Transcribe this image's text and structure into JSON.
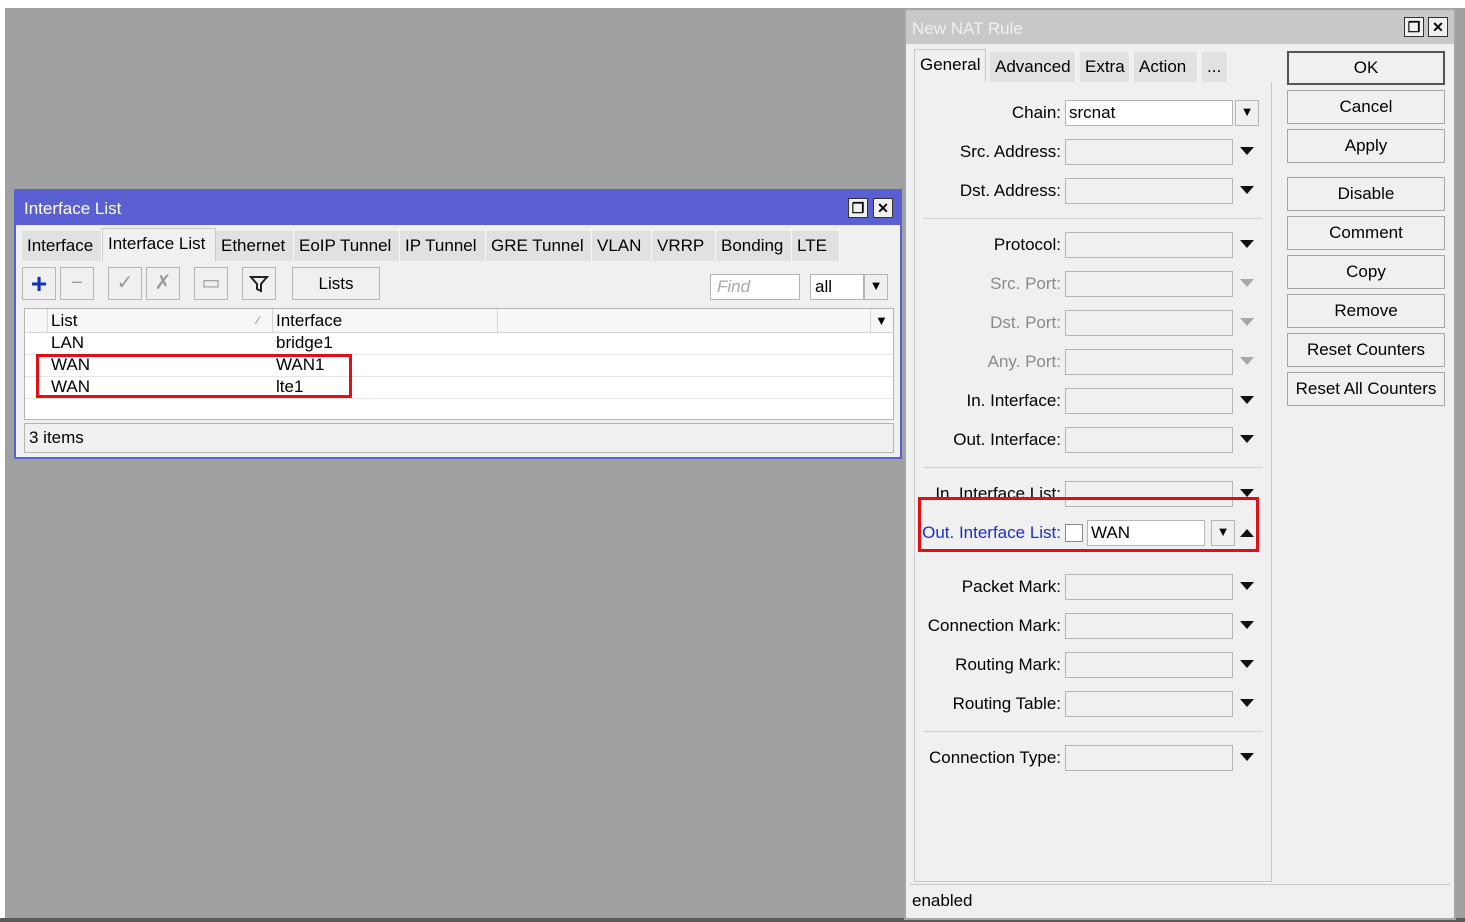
{
  "iface_window": {
    "title": "Interface List",
    "tabs": [
      "Interface",
      "Interface List",
      "Ethernet",
      "EoIP Tunnel",
      "IP Tunnel",
      "GRE Tunnel",
      "VLAN",
      "VRRP",
      "Bonding",
      "LTE"
    ],
    "active_tab": "Interface List",
    "lists_button": "Lists",
    "find_placeholder": "Find",
    "filter_value": "all",
    "columns": [
      "List",
      "Interface"
    ],
    "rows": [
      {
        "list": "LAN",
        "interface": "bridge1"
      },
      {
        "list": "WAN",
        "interface": "WAN1"
      },
      {
        "list": "WAN",
        "interface": "lte1"
      }
    ],
    "status": "3 items"
  },
  "nat_window": {
    "title": "New NAT Rule",
    "tabs": [
      "General",
      "Advanced",
      "Extra",
      "Action",
      "..."
    ],
    "active_tab": "General",
    "fields": {
      "chain": {
        "label": "Chain:",
        "value": "srcnat"
      },
      "src_address": {
        "label": "Src. Address:"
      },
      "dst_address": {
        "label": "Dst. Address:"
      },
      "protocol": {
        "label": "Protocol:"
      },
      "src_port": {
        "label": "Src. Port:"
      },
      "dst_port": {
        "label": "Dst. Port:"
      },
      "any_port": {
        "label": "Any. Port:"
      },
      "in_interface": {
        "label": "In. Interface:"
      },
      "out_interface": {
        "label": "Out. Interface:"
      },
      "in_interface_list": {
        "label": "In. Interface List:"
      },
      "out_interface_list": {
        "label": "Out. Interface List:",
        "value": "WAN"
      },
      "packet_mark": {
        "label": "Packet Mark:"
      },
      "connection_mark": {
        "label": "Connection Mark:"
      },
      "routing_mark": {
        "label": "Routing Mark:"
      },
      "routing_table": {
        "label": "Routing Table:"
      },
      "connection_type": {
        "label": "Connection Type:"
      }
    },
    "buttons": [
      "OK",
      "Cancel",
      "Apply",
      "Disable",
      "Comment",
      "Copy",
      "Remove",
      "Reset Counters",
      "Reset All Counters"
    ],
    "status": "enabled"
  },
  "colors": {
    "active_title": "#5a5fd1",
    "highlight": "#e10f13",
    "link_label": "#1a2fd0"
  },
  "icons": [
    "add-icon",
    "remove-icon",
    "enable-icon",
    "disable-icon",
    "comment-icon",
    "filter-icon",
    "restore-icon",
    "close-icon",
    "dropdown-icon"
  ]
}
